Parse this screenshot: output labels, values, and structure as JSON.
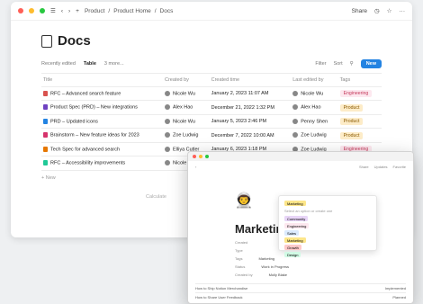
{
  "window": {
    "breadcrumb": [
      "Product",
      "Product Home",
      "Docs"
    ],
    "share": "Share",
    "more": "···"
  },
  "page": {
    "title": "Docs",
    "views": [
      "Recently edited",
      "Table",
      "3 more..."
    ],
    "filter": "Filter",
    "sort": "Sort",
    "new_button": "New",
    "new_row": "+ New",
    "calculate": "Calculate",
    "columns": [
      "Title",
      "Created by",
      "Created time",
      "Last edited by",
      "Tags"
    ],
    "rows": [
      {
        "title": "RFC – Advanced search feature",
        "created_by": "Nicole Wu",
        "created_time": "January 2, 2023 11:07 AM",
        "last_edited": "Nicole Wu",
        "tag": "Engineering"
      },
      {
        "title": "Product Spec (PRD) – New integrations",
        "created_by": "Alex Hao",
        "created_time": "December 21, 2022 1:32 PM",
        "last_edited": "Alex Hao",
        "tag": "Product"
      },
      {
        "title": "PRD – Updated icons",
        "created_by": "Nicole Wu",
        "created_time": "January 5, 2023 2:46 PM",
        "last_edited": "Penny Shen",
        "tag": "Product"
      },
      {
        "title": "Brainstorm – New feature ideas for 2023",
        "created_by": "Zoe Ludwig",
        "created_time": "December 7, 2022 10:00 AM",
        "last_edited": "Zoe Ludwig",
        "tag": "Product"
      },
      {
        "title": "Tech Spec for advanced search",
        "created_by": "Elliya Cutler",
        "created_time": "January 6, 2023 1:18 PM",
        "last_edited": "Zoe Ludwig",
        "tag": "Engineering"
      },
      {
        "title": "RFC – Accessibility improvements",
        "created_by": "Nicole Wu",
        "created_time": "",
        "last_edited": "",
        "tag": ""
      }
    ]
  },
  "overlay": {
    "title": "Marketing",
    "share": "Share",
    "updates": "Updates",
    "favorite": "Favorite",
    "props": [
      "Created",
      "Type",
      "Tags",
      "Status",
      "Created by"
    ],
    "prop_values": [
      "",
      "",
      "Marketing",
      "Work in Progress",
      "Molly Blake"
    ],
    "dropdown_hint": "Select an option or create one",
    "dropdown_selected": "Marketing",
    "dropdown_options": [
      "Community",
      "Engineering",
      "Sales",
      "Marketing",
      "Growth",
      "Design"
    ],
    "bottom": [
      {
        "label": "How to Ship Notion Merchandise",
        "right": "Implemented"
      },
      {
        "label": "How to Share User Feedback",
        "right": "Planned"
      }
    ]
  },
  "colors": {
    "accent": "#2383e2",
    "engineering_bg": "#fde8ef",
    "engineering_fg": "#c4385a",
    "product_bg": "#fdecc8",
    "product_fg": "#8a5a00"
  }
}
